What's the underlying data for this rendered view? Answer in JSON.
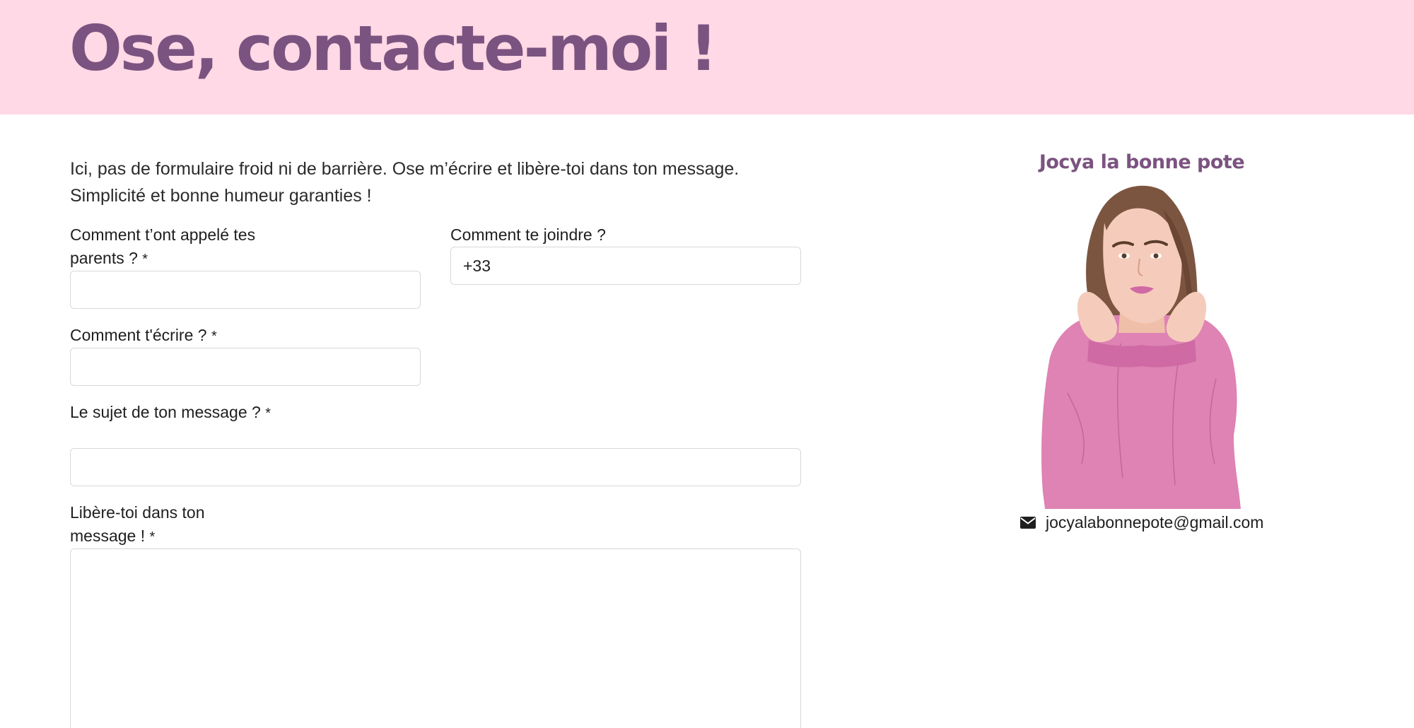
{
  "hero": {
    "title": "Ose, contacte-moi !",
    "background_color": "#ffd9e5",
    "title_color": "#7b5380"
  },
  "intro": {
    "text": "Ici, pas de formulaire froid ni de barrière. Ose m’écrire et libère-toi dans ton message. Simplicité et bonne humeur garanties !"
  },
  "form": {
    "required_marker": "*",
    "name": {
      "label": "Comment t’ont appelé tes parents ?",
      "value": "",
      "required": true
    },
    "phone": {
      "label": "Comment te joindre ?",
      "value": "+33",
      "required": false
    },
    "email": {
      "label": "Comment t'écrire ?",
      "value": "",
      "required": true
    },
    "subject": {
      "label": "Le sujet de ton message ?",
      "value": "",
      "required": true
    },
    "message": {
      "label": "Libère-toi dans ton message !",
      "value": "",
      "required": true
    }
  },
  "sidebar": {
    "name": "Jocya la bonne pote",
    "name_color": "#7b5380",
    "portrait_icon": "woman-portrait-illustration",
    "contact_icon": "envelope-icon",
    "email": "jocyalabonnepote@gmail.com"
  }
}
